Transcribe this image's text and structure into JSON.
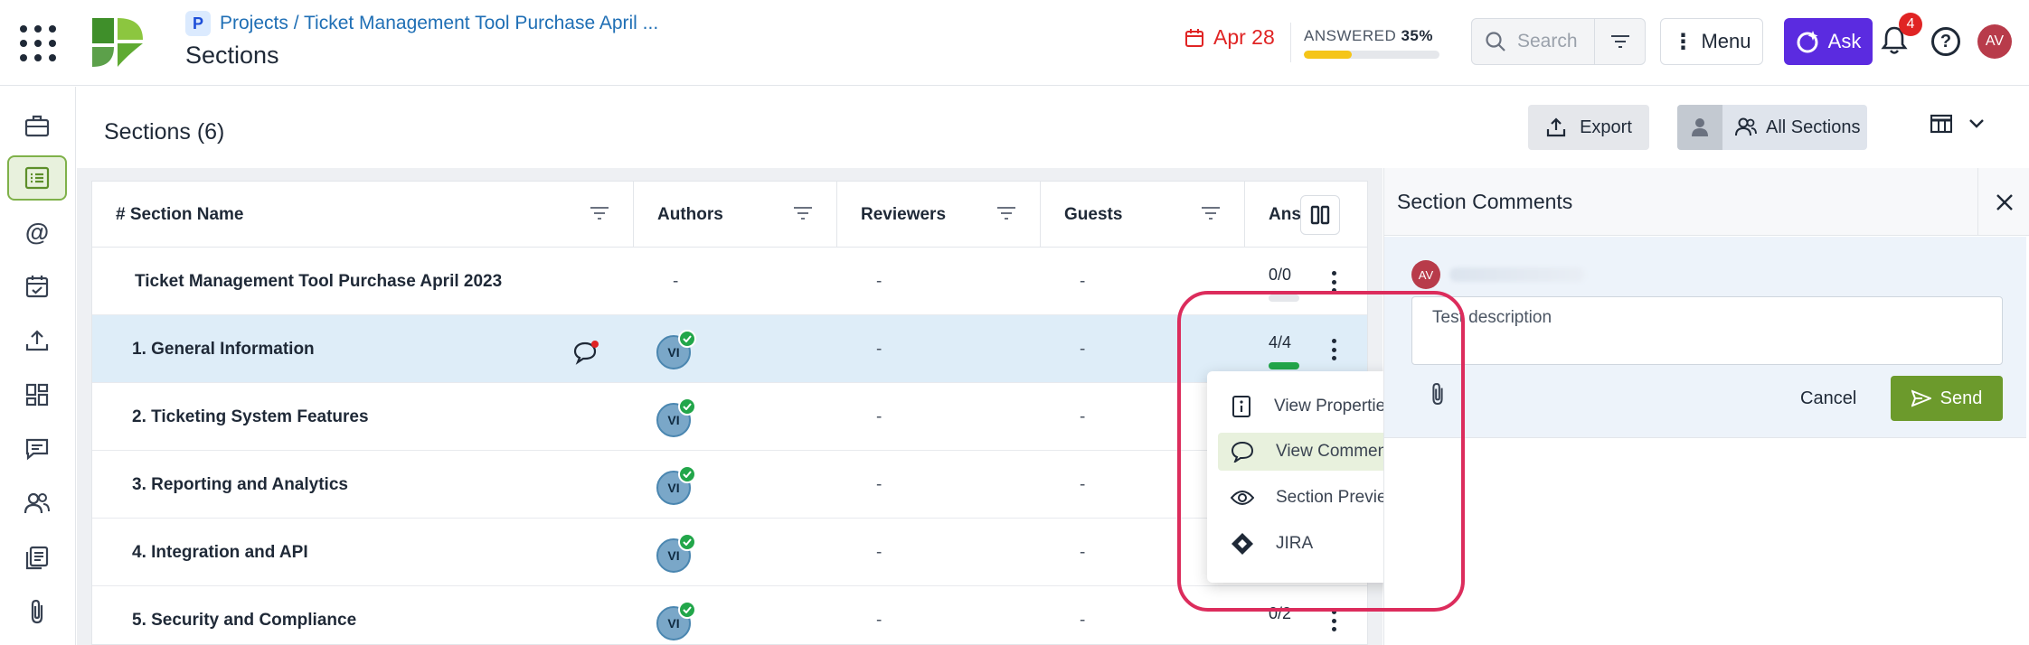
{
  "header": {
    "breadcrumb": "Projects / Ticket Management Tool Purchase April ...",
    "breadcrumb_icon": "P",
    "title": "Sections",
    "due_date": "Apr 28",
    "answered_label": "ANSWERED",
    "answered_pct": "35%",
    "answered_fraction": 0.35,
    "search_placeholder": "Search",
    "menu_label": "Menu",
    "ask_label": "Ask",
    "notifications_count": "4",
    "avatar_initials": "AV",
    "colors": {
      "due": "#e02424",
      "ask": "#5b2be0",
      "progress": "#f5c518",
      "accent": "#7fb14a"
    }
  },
  "rail": {
    "items": [
      "briefcase-icon",
      "sections-list-icon",
      "mention-icon",
      "calendar-check-icon",
      "upload-icon",
      "dashboard-icon",
      "chat-icon",
      "users-icon",
      "copy-icon",
      "attachment-icon"
    ],
    "active_index": 1
  },
  "content": {
    "title": "Sections (6)",
    "export_label": "Export",
    "all_sections_label": "All Sections"
  },
  "table": {
    "columns": [
      "# Section Name",
      "Authors",
      "Reviewers",
      "Guests",
      "Ans"
    ],
    "rows": [
      {
        "name": "Ticket Management Tool Purchase April 2023",
        "author": "-",
        "reviewers": "-",
        "guests": "-",
        "answered": "0/0",
        "fill": 0
      },
      {
        "name": "1. General Information",
        "author": "VI",
        "reviewers": "-",
        "guests": "-",
        "answered": "4/4",
        "fill": 1
      },
      {
        "name": "2. Ticketing System Features",
        "author": "VI",
        "reviewers": "-",
        "guests": "-",
        "answered": "",
        "fill": 0
      },
      {
        "name": "3. Reporting and Analytics",
        "author": "VI",
        "reviewers": "-",
        "guests": "-",
        "answered": "",
        "fill": 0
      },
      {
        "name": "4. Integration and API",
        "author": "VI",
        "reviewers": "-",
        "guests": "-",
        "answered": "",
        "fill": 0
      },
      {
        "name": "5. Security and Compliance",
        "author": "VI",
        "reviewers": "-",
        "guests": "-",
        "answered": "0/2",
        "fill": 0
      }
    ]
  },
  "context_menu": {
    "items": [
      "View Properties",
      "View Comments",
      "Section Preview",
      "JIRA"
    ],
    "highlighted": "View Comments"
  },
  "comments_panel": {
    "title": "Section Comments",
    "avatar_initials": "AV",
    "comment_text": "Test description",
    "cancel_label": "Cancel",
    "send_label": "Send"
  }
}
